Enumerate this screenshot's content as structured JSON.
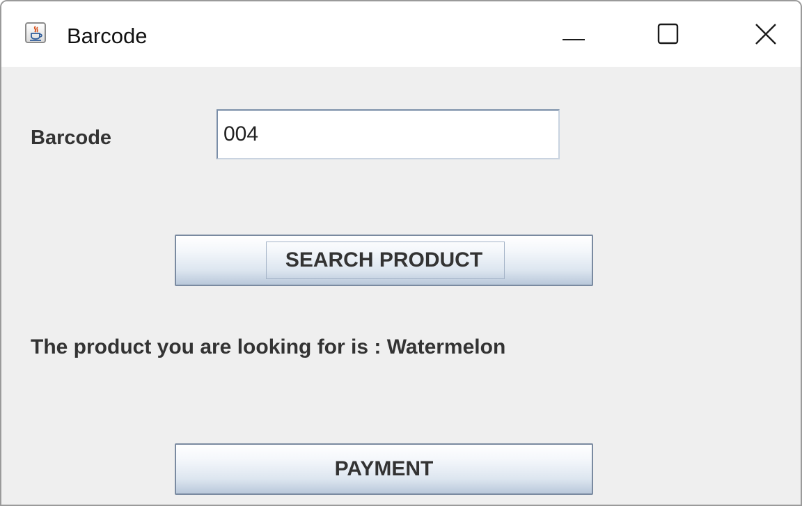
{
  "window": {
    "title": "Barcode",
    "controls": {
      "minimize_icon": "minimize-icon",
      "maximize_icon": "maximize-icon",
      "close_icon": "close-icon"
    },
    "app_icon": "java-cup-icon"
  },
  "form": {
    "barcode_label": "Barcode",
    "barcode_value": "004",
    "search_button_label": "SEARCH PRODUCT",
    "result_text": "The product you are looking for is :  Watermelon",
    "payment_button_label": "PAYMENT"
  },
  "colors": {
    "background": "#efefef",
    "titlebar": "#ffffff",
    "text": "#333333",
    "button_border": "#7a8aa0"
  }
}
